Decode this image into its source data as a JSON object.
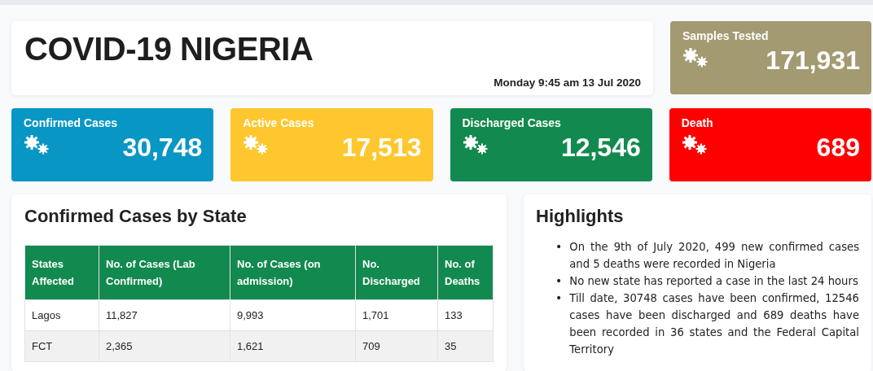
{
  "header": {
    "title": "COVID-19 NIGERIA",
    "timestamp": "Monday 9:45 am 13 Jul 2020"
  },
  "samples": {
    "label": "Samples Tested",
    "value": "171,931",
    "color": "#a39a72"
  },
  "stats": [
    {
      "label": "Confirmed Cases",
      "value": "30,748",
      "color": "#0896c5"
    },
    {
      "label": "Active Cases",
      "value": "17,513",
      "color": "#fec72e"
    },
    {
      "label": "Discharged Cases",
      "value": "12,546",
      "color": "#128a4f"
    },
    {
      "label": "Death",
      "value": "689",
      "color": "#ff0000"
    }
  ],
  "table_card": {
    "title": "Confirmed Cases by State",
    "columns": [
      "States Affected",
      "No. of Cases (Lab Confirmed)",
      "No. of Cases (on admission)",
      "No. Discharged",
      "No. of Deaths"
    ],
    "rows": [
      [
        "Lagos",
        "11,827",
        "9,993",
        "1,701",
        "133"
      ],
      [
        "FCT",
        "2,365",
        "1,621",
        "709",
        "35"
      ]
    ]
  },
  "highlights": {
    "title": "Highlights",
    "items": [
      {
        "bullet": "•",
        "text": "On the 9th of July 2020, 499 new confirmed cases and 5 deaths were recorded in Nigeria"
      },
      {
        "bullet": "•",
        "text": "No new state has reported a case in the last 24 hours"
      },
      {
        "bullet": "•",
        "text": "Till date, 30748 cases have been confirmed, 12546 cases have been discharged and 689 deaths have been recorded in 36 states and the Federal Capital Territory"
      }
    ]
  }
}
